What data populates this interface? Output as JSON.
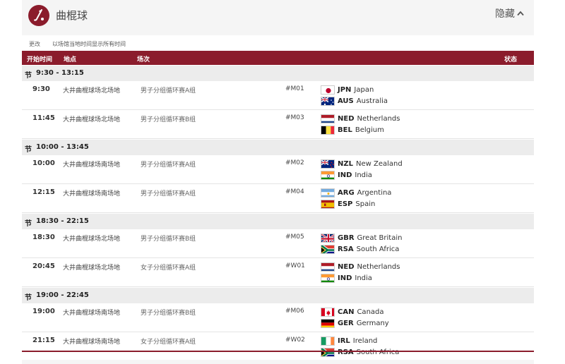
{
  "header": {
    "title": "曲棍球",
    "hide_label": "隐藏",
    "icon": "field-hockey-icon"
  },
  "timezone": {
    "change_label": "更改",
    "note": "以场馆当地时间显示所有时间"
  },
  "columns": {
    "time": "开始时间",
    "venue": "地点",
    "event": "场次",
    "status": "状态"
  },
  "colors": {
    "brand": "#8b1c2c"
  },
  "sessions": [
    {
      "label": "节",
      "time": "9:30 - 13:15",
      "matches": [
        {
          "time": "9:30",
          "venue": "大井曲棍球场北场地",
          "event": "男子分组循环赛A组",
          "code": "#M01",
          "team1": {
            "flag": "jpn",
            "code": "JPN",
            "name": "Japan"
          },
          "team2": {
            "flag": "aus",
            "code": "AUS",
            "name": "Australia"
          }
        },
        {
          "time": "11:45",
          "venue": "大井曲棍球场北场地",
          "event": "男子分组循环赛B组",
          "code": "#M03",
          "team1": {
            "flag": "ned",
            "code": "NED",
            "name": "Netherlands"
          },
          "team2": {
            "flag": "bel",
            "code": "BEL",
            "name": "Belgium"
          }
        }
      ]
    },
    {
      "label": "节",
      "time": "10:00 - 13:45",
      "matches": [
        {
          "time": "10:00",
          "venue": "大井曲棍球场南场地",
          "event": "男子分组循环赛A组",
          "code": "#M02",
          "team1": {
            "flag": "nzl",
            "code": "NZL",
            "name": "New Zealand"
          },
          "team2": {
            "flag": "ind",
            "code": "IND",
            "name": "India"
          }
        },
        {
          "time": "12:15",
          "venue": "大井曲棍球场南场地",
          "event": "男子分组循环赛A组",
          "code": "#M04",
          "team1": {
            "flag": "arg",
            "code": "ARG",
            "name": "Argentina"
          },
          "team2": {
            "flag": "esp",
            "code": "ESP",
            "name": "Spain"
          }
        }
      ]
    },
    {
      "label": "节",
      "time": "18:30 - 22:15",
      "matches": [
        {
          "time": "18:30",
          "venue": "大井曲棍球场北场地",
          "event": "男子分组循环赛B组",
          "code": "#M05",
          "team1": {
            "flag": "gbr",
            "code": "GBR",
            "name": "Great Britain"
          },
          "team2": {
            "flag": "rsa",
            "code": "RSA",
            "name": "South Africa"
          }
        },
        {
          "time": "20:45",
          "venue": "大井曲棍球场北场地",
          "event": "女子分组循环赛A组",
          "code": "#W01",
          "team1": {
            "flag": "ned",
            "code": "NED",
            "name": "Netherlands"
          },
          "team2": {
            "flag": "ind",
            "code": "IND",
            "name": "India"
          }
        }
      ]
    },
    {
      "label": "节",
      "time": "19:00 - 22:45",
      "matches": [
        {
          "time": "19:00",
          "venue": "大井曲棍球场南场地",
          "event": "男子分组循环赛B组",
          "code": "#M06",
          "team1": {
            "flag": "can",
            "code": "CAN",
            "name": "Canada"
          },
          "team2": {
            "flag": "ger",
            "code": "GER",
            "name": "Germany"
          }
        },
        {
          "time": "21:15",
          "venue": "大井曲棍球场南场地",
          "event": "女子分组循环赛A组",
          "code": "#W02",
          "team1": {
            "flag": "irl",
            "code": "IRL",
            "name": "Ireland"
          },
          "team2": {
            "flag": "rsa",
            "code": "RSA",
            "name": "South Africa"
          }
        }
      ]
    }
  ]
}
